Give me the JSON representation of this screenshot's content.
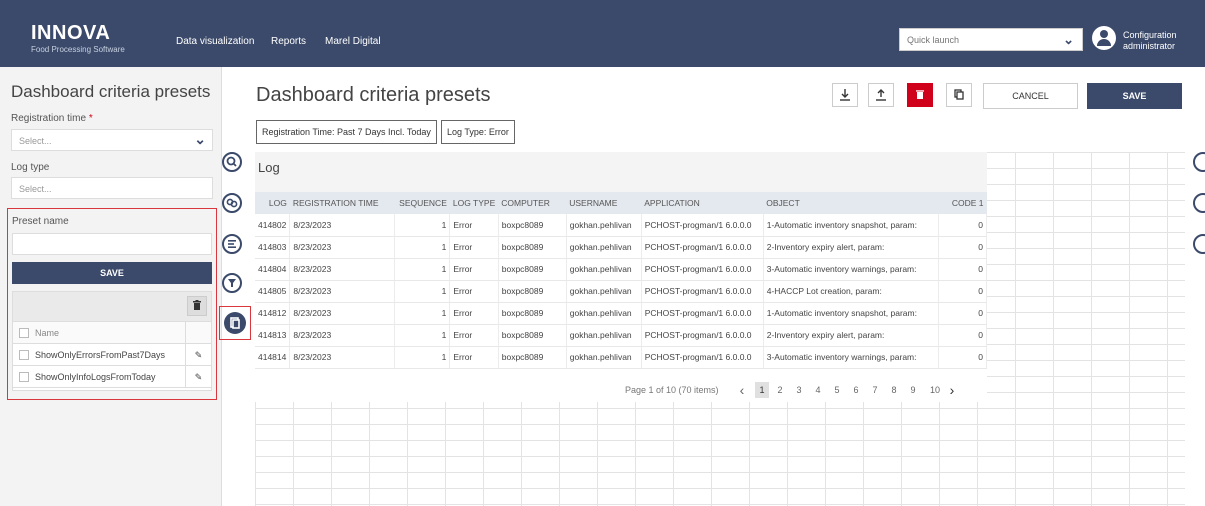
{
  "header": {
    "brand": "INNOVA",
    "brand_sub": "Food Processing Software",
    "nav": [
      "Data visualization",
      "Reports",
      "Marel Digital"
    ],
    "quick_launch_placeholder": "Quick launch",
    "user_line1": "Configuration",
    "user_line2": "administrator"
  },
  "left_panel": {
    "title": "Dashboard criteria presets",
    "registration_time_label": "Registration time",
    "registration_time_required": "*",
    "registration_time_placeholder": "Select...",
    "log_type_label": "Log type",
    "log_type_placeholder": "Select...",
    "preset_name_label": "Preset name",
    "save_label": "SAVE",
    "presets_header": "Name",
    "presets": [
      {
        "name": "ShowOnlyErrorsFromPast7Days"
      },
      {
        "name": "ShowOnlyInfoLogsFromToday"
      }
    ]
  },
  "main": {
    "title": "Dashboard criteria presets",
    "cancel_label": "CANCEL",
    "save_label": "SAVE",
    "chips": [
      "Registration Time: Past 7 Days Incl. Today",
      "Log Type: Error"
    ]
  },
  "log": {
    "title": "Log",
    "columns": [
      "LOG",
      "REGISTRATION TIME",
      "SEQUENCE",
      "LOG TYPE",
      "COMPUTER",
      "USERNAME",
      "APPLICATION",
      "OBJECT",
      "CODE 1"
    ],
    "rows": [
      [
        "414802",
        "8/23/2023",
        "1",
        "Error",
        "boxpc8089",
        "gokhan.pehlivan",
        "PCHOST-progman/1 6.0.0.0",
        "1-Automatic inventory snapshot, param:",
        "0"
      ],
      [
        "414803",
        "8/23/2023",
        "1",
        "Error",
        "boxpc8089",
        "gokhan.pehlivan",
        "PCHOST-progman/1 6.0.0.0",
        "2-Inventory expiry alert, param:",
        "0"
      ],
      [
        "414804",
        "8/23/2023",
        "1",
        "Error",
        "boxpc8089",
        "gokhan.pehlivan",
        "PCHOST-progman/1 6.0.0.0",
        "3-Automatic inventory warnings, param:",
        "0"
      ],
      [
        "414805",
        "8/23/2023",
        "1",
        "Error",
        "boxpc8089",
        "gokhan.pehlivan",
        "PCHOST-progman/1 6.0.0.0",
        "4-HACCP Lot creation, param:",
        "0"
      ],
      [
        "414812",
        "8/23/2023",
        "1",
        "Error",
        "boxpc8089",
        "gokhan.pehlivan",
        "PCHOST-progman/1 6.0.0.0",
        "1-Automatic inventory snapshot, param:",
        "0"
      ],
      [
        "414813",
        "8/23/2023",
        "1",
        "Error",
        "boxpc8089",
        "gokhan.pehlivan",
        "PCHOST-progman/1 6.0.0.0",
        "2-Inventory expiry alert, param:",
        "0"
      ],
      [
        "414814",
        "8/23/2023",
        "1",
        "Error",
        "boxpc8089",
        "gokhan.pehlivan",
        "PCHOST-progman/1 6.0.0.0",
        "3-Automatic inventory warnings, param:",
        "0"
      ]
    ],
    "pager_info": "Page 1 of 10 (70 items)",
    "pages": [
      "1",
      "2",
      "3",
      "4",
      "5",
      "6",
      "7",
      "8",
      "9",
      "10"
    ],
    "prev": "‹",
    "next": "›"
  },
  "colors": {
    "primary": "#3b4a6b",
    "danger": "#d0021b",
    "highlight": "#d9363e"
  },
  "icons": [
    "search-icon",
    "link-icon",
    "list-icon",
    "filter-icon",
    "preset-icon",
    "download-icon",
    "upload-icon",
    "trash-icon",
    "copy-icon",
    "edit-icon",
    "chevron-down-icon",
    "user-icon"
  ]
}
